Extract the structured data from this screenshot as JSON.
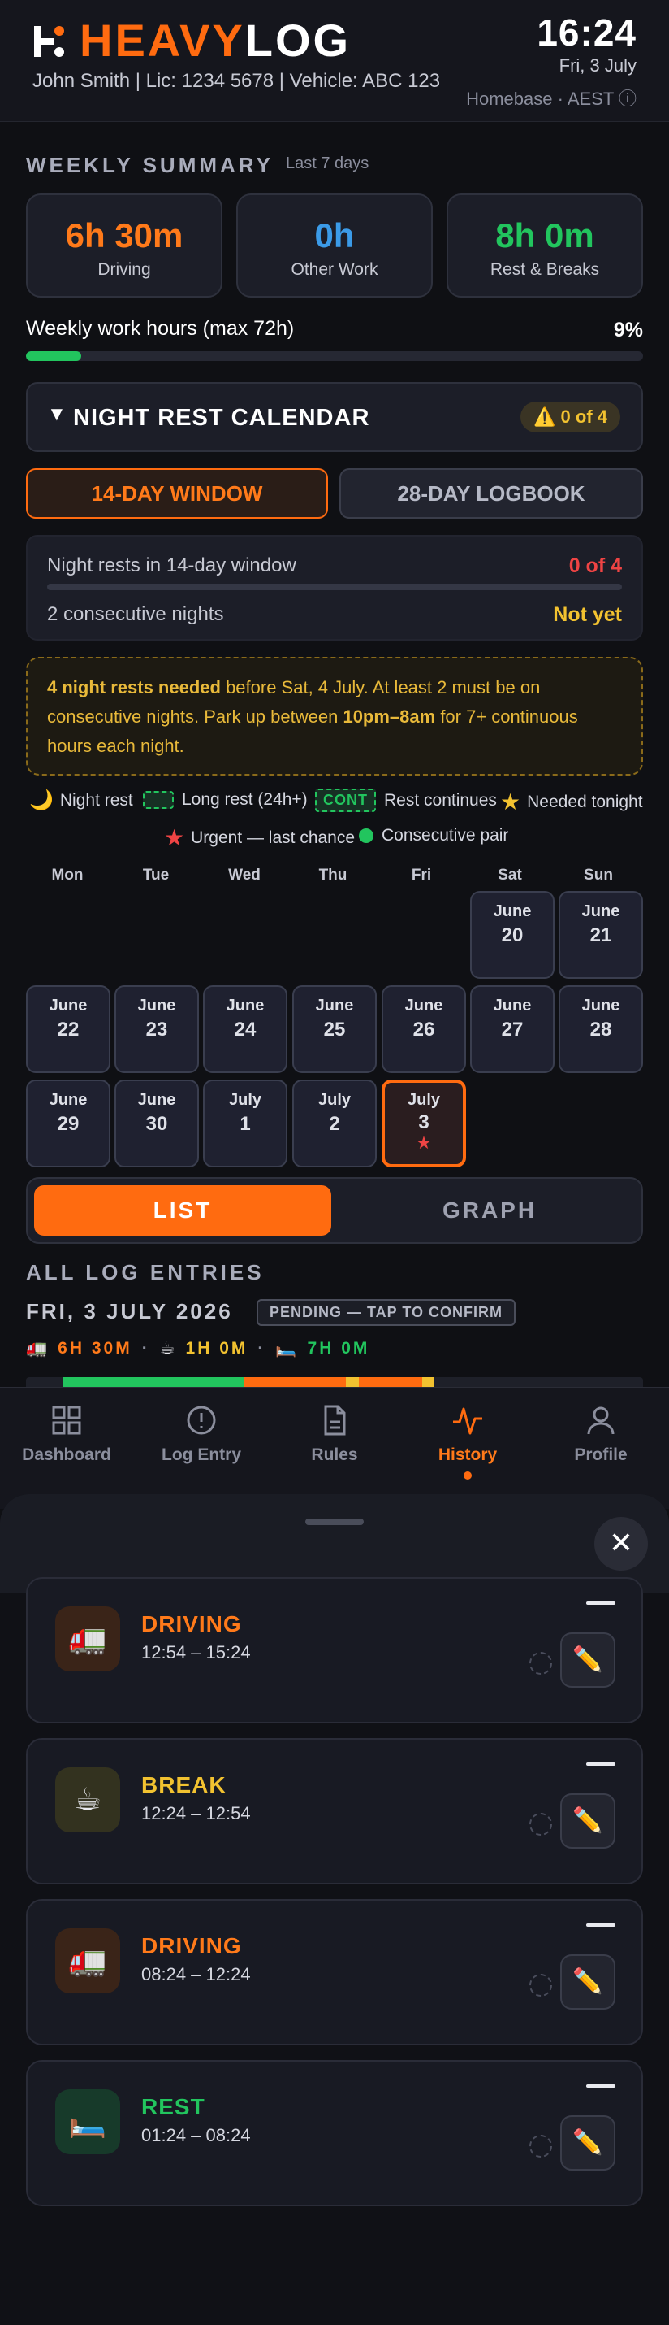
{
  "header": {
    "logo_part1": "HEAVY",
    "logo_part2": "LOG",
    "user_line": "John Smith | Lic: 1234 5678 | Vehicle: ABC 123",
    "time": "16:24",
    "date": "Fri, 3 July",
    "timezone": "Homebase · AEST ⓘ"
  },
  "weekly": {
    "title": "WEEKLY SUMMARY",
    "subtitle": "Last 7 days",
    "stats": [
      {
        "value": "6h 30m",
        "label": "Driving",
        "color": "#ff7a1a"
      },
      {
        "value": "0h",
        "label": "Other Work",
        "color": "#3b9be8"
      },
      {
        "value": "8h 0m",
        "label": "Rest & Breaks",
        "color": "#22c55e"
      }
    ],
    "work_label": "Weekly work hours (max 72h)",
    "work_percent_label": "9%",
    "work_fraction": 0.09
  },
  "night_rest": {
    "title": "NIGHT REST CALENDAR",
    "badge": "⚠️ 0 of 4",
    "tabs": [
      "14-DAY WINDOW",
      "28-DAY LOGBOOK"
    ],
    "stat1_label": "Night rests in 14-day window",
    "stat1_value": "0 of 4",
    "stat2_label": "2 consecutive nights",
    "stat2_value": "Not yet",
    "alert_bold1": "4 night rests needed",
    "alert_text1": " before Sat, 4 July. At least 2 must be on consecutive nights. Park up between ",
    "alert_bold2": "10pm–8am",
    "alert_text2": " for 7+ continuous hours each night.",
    "legend": {
      "night": "Night rest",
      "long": "Long rest (24h+)",
      "cont_tag": "CONT",
      "cont": "Rest continues",
      "needed": "Needed tonight",
      "urgent": "Urgent — last chance",
      "pair": "Consecutive pair"
    },
    "weekdays": [
      "Mon",
      "Tue",
      "Wed",
      "Thu",
      "Fri",
      "Sat",
      "Sun"
    ],
    "days": [
      {
        "month": "June",
        "day": "20"
      },
      {
        "month": "June",
        "day": "21"
      },
      {
        "month": "June",
        "day": "22"
      },
      {
        "month": "June",
        "day": "23"
      },
      {
        "month": "June",
        "day": "24"
      },
      {
        "month": "June",
        "day": "25"
      },
      {
        "month": "June",
        "day": "26"
      },
      {
        "month": "June",
        "day": "27"
      },
      {
        "month": "June",
        "day": "28"
      },
      {
        "month": "June",
        "day": "29"
      },
      {
        "month": "June",
        "day": "30"
      },
      {
        "month": "July",
        "day": "1"
      },
      {
        "month": "July",
        "day": "2"
      },
      {
        "month": "July",
        "day": "3"
      }
    ]
  },
  "view_toggle": {
    "list": "LIST",
    "graph": "GRAPH"
  },
  "log": {
    "title": "ALL LOG ENTRIES",
    "date": "FRI, 3 JULY 2026",
    "pending": "PENDING — TAP TO CONFIRM",
    "drive_total": "6H 30M",
    "break_total": "1H 0M",
    "rest_total": "7H 0M"
  },
  "nav": [
    "Dashboard",
    "Log Entry",
    "Rules",
    "History",
    "Profile"
  ],
  "entries": [
    {
      "type": "DRIVING",
      "time": "12:54 – 15:24",
      "icon": "🚛",
      "color": "#ff7a1a"
    },
    {
      "type": "BREAK",
      "time": "12:24 – 12:54",
      "icon": "☕",
      "color": "#f2c230"
    },
    {
      "type": "DRIVING",
      "time": "08:24 – 12:24",
      "icon": "🚛",
      "color": "#ff7a1a"
    },
    {
      "type": "REST",
      "time": "01:24 – 08:24",
      "icon": "🛏️",
      "color": "#22c55e"
    }
  ]
}
